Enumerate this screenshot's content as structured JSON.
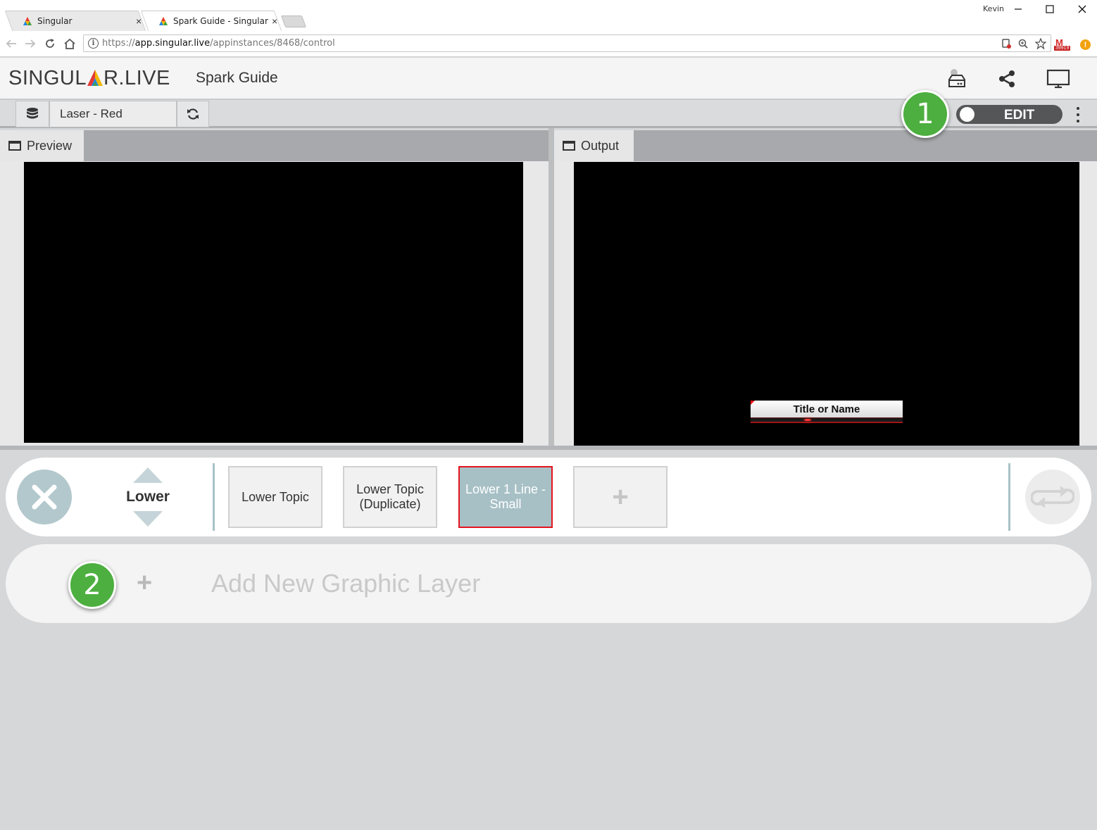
{
  "browser": {
    "tabs": [
      {
        "title": "Singular"
      },
      {
        "title": "Spark Guide - Singular"
      }
    ],
    "tab_close": "×",
    "user": "Kevin",
    "url_scheme": "https://",
    "url_host": "app.singular.live",
    "url_path": "/appinstances/8468/control",
    "extension_badge": "39919",
    "extension_letter": "M"
  },
  "app": {
    "logo_part1": "SINGUL",
    "logo_part2": "R.LIVE",
    "project_title": "Spark Guide"
  },
  "toolbar": {
    "data_source": "Laser - Red",
    "mode_label": "EDIT"
  },
  "panels": {
    "preview_label": "Preview",
    "output_label": "Output",
    "output_graphic_text": "Title or Name"
  },
  "layer": {
    "name": "Lower",
    "compositions": [
      {
        "label": "Lower Topic",
        "selected": false
      },
      {
        "label": "Lower Topic (Duplicate)",
        "selected": false
      },
      {
        "label": "Lower 1 Line - Small",
        "selected": true
      }
    ],
    "add_label": "+"
  },
  "add_layer": {
    "plus": "+",
    "label": "Add New Graphic Layer"
  },
  "callouts": [
    "1",
    "2"
  ],
  "colors": {
    "callout_green": "#4caf3f",
    "selected_border": "#e5141f",
    "selected_fill": "#a7c0c6",
    "toggle_bg": "#555657"
  }
}
